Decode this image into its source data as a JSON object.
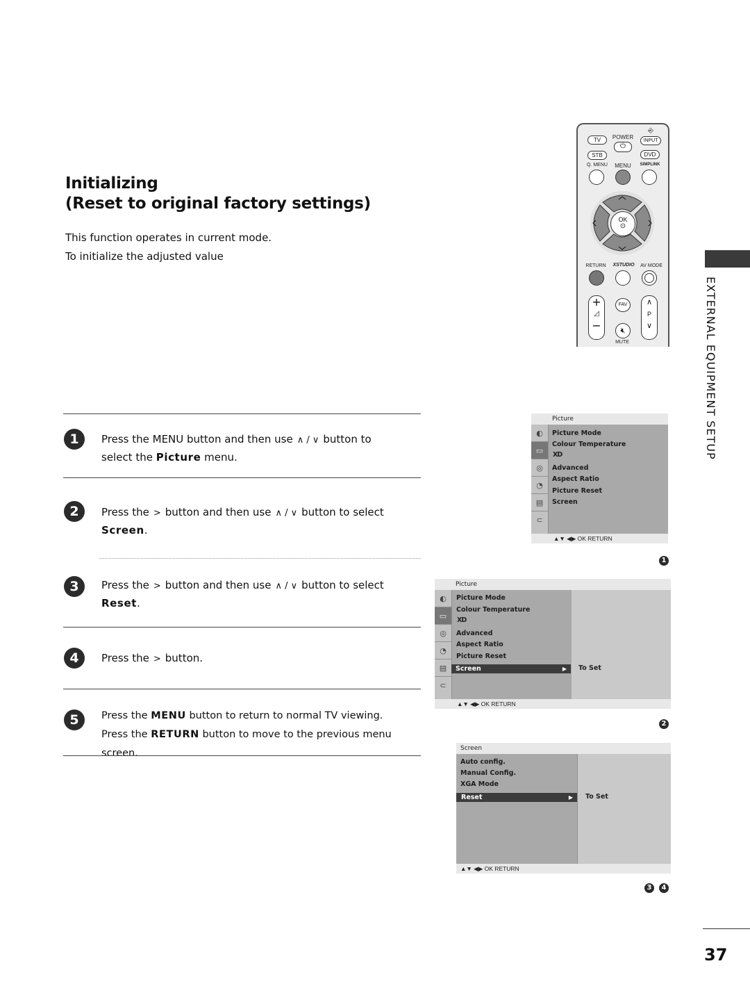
{
  "heading": {
    "line1": "Initializing",
    "line2": "(Reset to original factory settings)"
  },
  "intro": [
    "This function operates in current mode.",
    "To initialize the adjusted value"
  ],
  "section_tab": "EXTERNAL EQUIPMENT SETUP",
  "steps": [
    {
      "number": "1",
      "pre": "Press the MENU button and then use",
      "glyph": "∧ / ∨",
      "post": "button to",
      "line2_pre": "select the",
      "bold": "Picture",
      "line2_post": "menu."
    },
    {
      "number": "2",
      "pre": "Press the",
      "glyph_a": ">",
      "mid": "button and then use",
      "glyph": "∧ / ∨",
      "post": "button to select",
      "bold": "Screen",
      "line2_post": "."
    },
    {
      "number": "3",
      "pre": "Press the",
      "glyph_a": ">",
      "mid": "button and then use",
      "glyph": "∧ / ∨",
      "post": "button to select",
      "bold": "Reset",
      "line2_post": "."
    },
    {
      "number": "4",
      "pre": "Press the",
      "glyph_a": ">",
      "post": "button."
    },
    {
      "number": "5",
      "l1_pre": "Press the",
      "l1_bold": "MENU",
      "l1_post": "button to return to normal TV viewing.",
      "l2_pre": "Press the",
      "l2_bold": "RETURN",
      "l2_post": "button to move to the previous menu screen."
    }
  ],
  "remote": {
    "tv": "TV",
    "power": "POWER",
    "input": "INPUT",
    "stb": "STB",
    "dvd": "DVD",
    "qmenu": "Q. MENU",
    "menu": "MENU",
    "simplink": "SIMPLINK",
    "ok": "OK",
    "return": "RETURN",
    "xstudio": "XSTUDIO",
    "avmode": "AV MODE",
    "fav": "FAV",
    "p": "P",
    "mute": "MUTE",
    "plus": "+",
    "minus": "−"
  },
  "osd1": {
    "header": "Picture",
    "items": [
      "Picture Mode",
      "Colour Temperature",
      "XD",
      "Advanced",
      "Aspect Ratio",
      "Picture Reset",
      "Screen"
    ],
    "footer": "▲▼  ◀▶  OK  RETURN",
    "badge": "1"
  },
  "osd2": {
    "header": "Picture",
    "items": [
      "Picture Mode",
      "Colour Temperature",
      "XD",
      "Advanced",
      "Aspect Ratio",
      "Picture Reset"
    ],
    "selected": "Screen",
    "selected_arrow": "▶",
    "right_value": "To Set",
    "footer": "▲▼  ◀▶  OK  RETURN",
    "badge": "2"
  },
  "osd3": {
    "header": "Screen",
    "items": [
      "Auto config.",
      "Manual Config.",
      "XGA Mode"
    ],
    "selected": "Reset",
    "selected_arrow": "▶",
    "right_value": "To Set",
    "footer": "▲▼  ◀▶  OK  RETURN",
    "badges": [
      "3",
      "4"
    ]
  },
  "osd_icons": [
    "picture-menu-icon",
    "screen-icon",
    "audio-icon",
    "time-icon",
    "option-icon",
    "input-icon"
  ],
  "page_number": "37",
  "colors": {
    "osd_body": "#a9a9a9",
    "osd_selected": "#3c3c3c",
    "osd_header": "#e8e8e8",
    "section_tab": "#3a3a3a"
  }
}
